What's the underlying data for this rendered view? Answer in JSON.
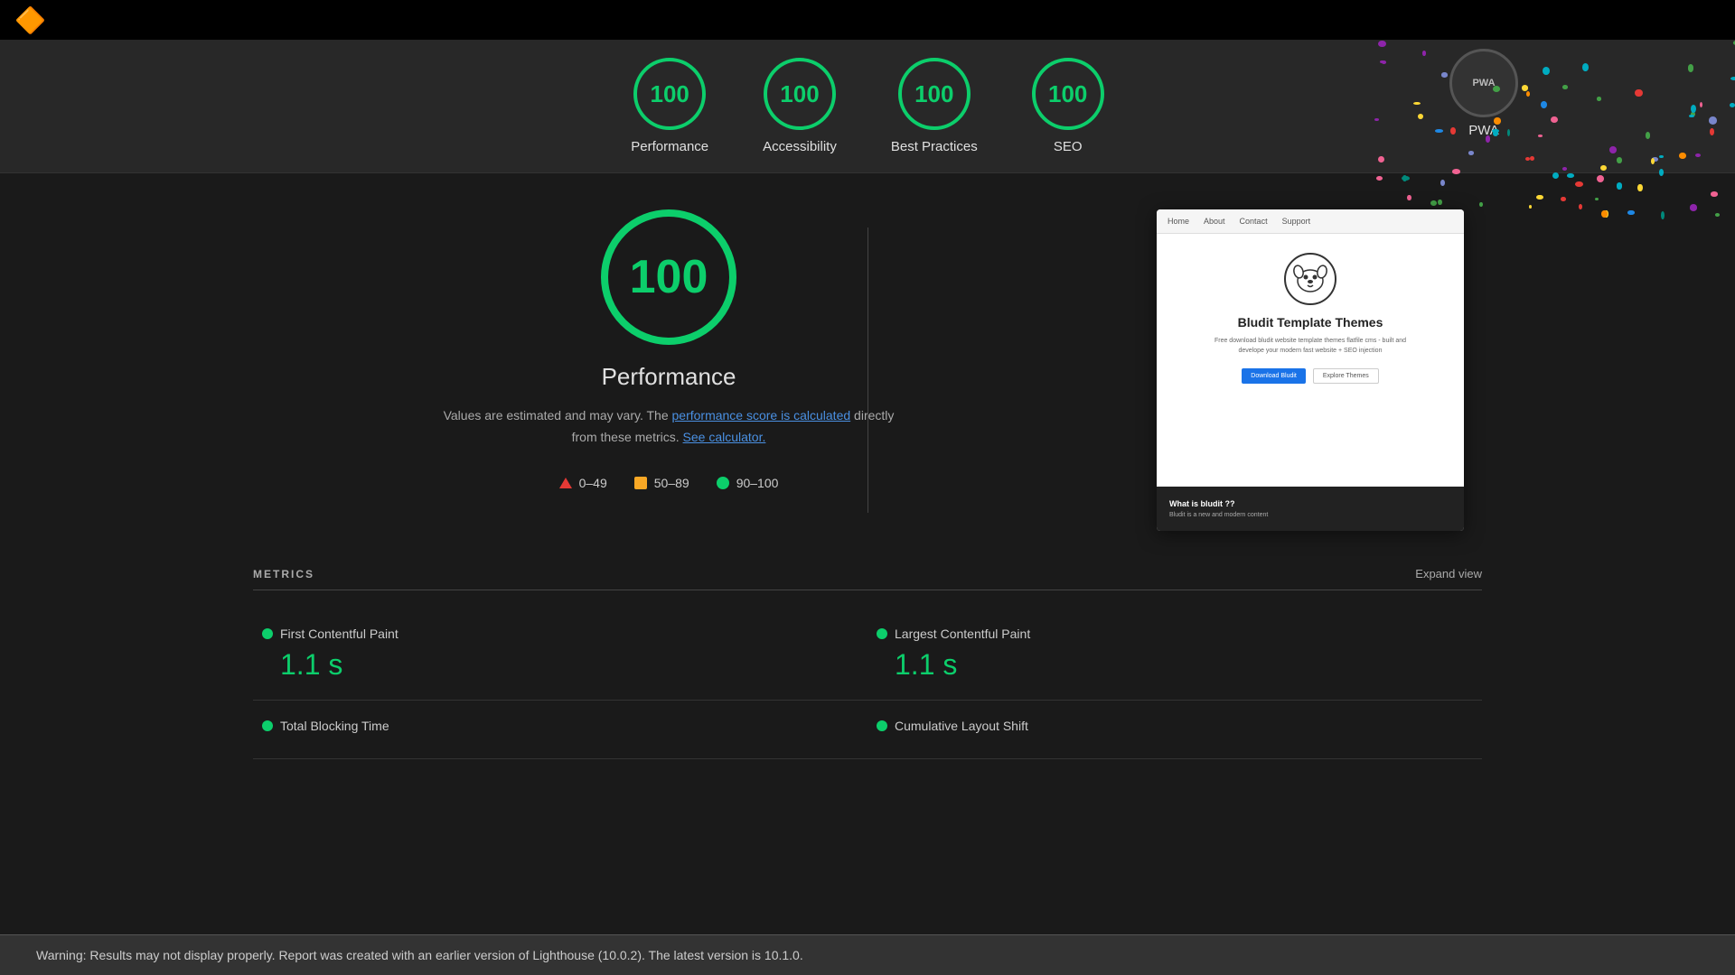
{
  "topbar": {
    "logo": "🔶"
  },
  "scores": [
    {
      "id": "performance",
      "value": "100",
      "label": "Performance"
    },
    {
      "id": "accessibility",
      "value": "100",
      "label": "Accessibility"
    },
    {
      "id": "best-practices",
      "value": "100",
      "label": "Best Practices"
    },
    {
      "id": "seo",
      "value": "100",
      "label": "SEO"
    }
  ],
  "pwa": {
    "label": "PWA",
    "badge": "PWA"
  },
  "main": {
    "score": "100",
    "title": "Performance",
    "description_prefix": "Values are estimated and may vary. The ",
    "description_link": "performance score is calculated",
    "description_middle": " directly from these metrics. ",
    "description_link2": "See calculator.",
    "legend": [
      {
        "type": "triangle",
        "range": "0–49"
      },
      {
        "type": "square",
        "range": "50–89"
      },
      {
        "type": "circle",
        "range": "90–100"
      }
    ]
  },
  "preview": {
    "nav_items": [
      "Home",
      "About",
      "Contact",
      "Support"
    ],
    "site_title": "Bludit Template Themes",
    "site_desc": "Free download bludit website template themes flatfile cms - built and develope your modern fast website + SEO injection",
    "btn_download": "Download Bludit",
    "btn_explore": "Explore Themes",
    "footer_title": "What is bludit ??",
    "footer_text": "Bludit is a new and modern content"
  },
  "metrics": {
    "title": "METRICS",
    "expand": "Expand view",
    "items": [
      {
        "id": "fcp",
        "name": "First Contentful Paint",
        "value": "1.1 s",
        "color": "green"
      },
      {
        "id": "lcp",
        "name": "Largest Contentful Paint",
        "value": "1.1 s",
        "color": "green"
      },
      {
        "id": "tbt",
        "name": "Total Blocking Time",
        "value": "",
        "color": "green"
      },
      {
        "id": "cls",
        "name": "Cumulative Layout Shift",
        "value": "",
        "color": "green"
      }
    ]
  },
  "warning": {
    "text": "Warning: Results may not display properly. Report was created with an earlier version of Lighthouse (10.0.2). The latest version is 10.1.0."
  }
}
